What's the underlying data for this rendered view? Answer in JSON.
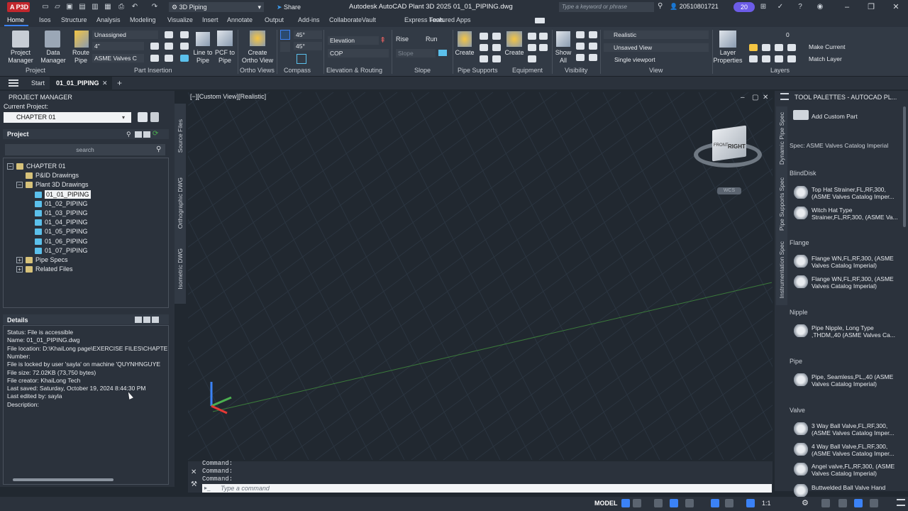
{
  "titlebar": {
    "app_badge": "A P3D",
    "workspace": "3D Piping",
    "share": "Share",
    "title": "Autodesk AutoCAD Plant 3D 2025   01_01_PIPING.dwg",
    "search_placeholder": "Type a keyword or phrase",
    "user": "20510801721",
    "notifications": "20"
  },
  "ribbon_tabs": [
    "Home",
    "Isos",
    "Structure",
    "Analysis",
    "Modeling",
    "Visualize",
    "Insert",
    "Annotate",
    "Output",
    "Add-ins",
    "Collaborate",
    "Vault",
    "Express Tools",
    "Featured Apps"
  ],
  "ribbon": {
    "project_manager": "Project\nManager",
    "data_manager": "Data\nManager",
    "route_pipe": "Route\nPipe",
    "layer_dropdown": "Unassigned",
    "size_dropdown": "4\"",
    "spec_dropdown": "ASME Valves C",
    "line_to_pipe": "Line to\nPipe",
    "pcf_to_pipe": "PCF to\nPipe",
    "create_ortho_view": "Create\nOrtho View",
    "angle1": "45°",
    "angle2": "45°",
    "elevation": "Elevation",
    "cop": "COP",
    "rise": "Rise",
    "run": "Run",
    "slope": "Slope",
    "create_supports": "Create",
    "create_equipment": "Create",
    "show_all": "Show\nAll",
    "visual_style": "Realistic",
    "saved_view": "Unsaved View",
    "viewport": "Single viewport",
    "layer_properties": "Layer\nProperties",
    "current_layer": "0",
    "make_current": "Make Current",
    "match_layer": "Match Layer",
    "groups": {
      "project": "Project",
      "part_insertion": "Part Insertion",
      "ortho_views": "Ortho Views",
      "compass": "Compass",
      "elevation_routing": "Elevation & Routing",
      "slope": "Slope",
      "pipe_supports": "Pipe Supports",
      "equipment": "Equipment",
      "visibility": "Visibility",
      "view": "View",
      "layers": "Layers"
    }
  },
  "doc_tabs": {
    "start": "Start",
    "active": "01_01_PIPING"
  },
  "project_manager": {
    "title": "PROJECT MANAGER",
    "current_project_label": "Current Project:",
    "current_project": "CHAPTER 01",
    "project_label": "Project",
    "search": "search",
    "tree": [
      {
        "label": "CHAPTER 01",
        "level": 0,
        "kind": "folder",
        "expand": "−"
      },
      {
        "label": "P&ID Drawings",
        "level": 1,
        "kind": "folder",
        "expand": ""
      },
      {
        "label": "Plant 3D Drawings",
        "level": 1,
        "kind": "folder",
        "expand": "−"
      },
      {
        "label": "01_01_PIPING",
        "level": 2,
        "kind": "file",
        "expand": "",
        "selected": true
      },
      {
        "label": "01_02_PIPING",
        "level": 2,
        "kind": "file",
        "expand": ""
      },
      {
        "label": "01_03_PIPING",
        "level": 2,
        "kind": "file",
        "expand": ""
      },
      {
        "label": "01_04_PIPING",
        "level": 2,
        "kind": "file",
        "expand": ""
      },
      {
        "label": "01_05_PIPING",
        "level": 2,
        "kind": "file",
        "expand": ""
      },
      {
        "label": "01_06_PIPING",
        "level": 2,
        "kind": "file",
        "expand": ""
      },
      {
        "label": "01_07_PIPING",
        "level": 2,
        "kind": "file",
        "expand": ""
      },
      {
        "label": "Pipe Specs",
        "level": 1,
        "kind": "folder",
        "expand": "+"
      },
      {
        "label": "Related Files",
        "level": 1,
        "kind": "folder",
        "expand": "+"
      }
    ],
    "details_label": "Details",
    "details": [
      "Status: File is accessible",
      "Name: 01_01_PIPING.dwg",
      "File location: D:\\KhaiLong page\\EXERCISE FILES\\CHAPTE",
      "Number:",
      "File is locked by user 'sayla' on machine 'QUYNHNGUYE",
      "File size: 72.02KB (73,750 bytes)",
      "File creator: KhaiLong Tech",
      "Last saved: Saturday, October 19, 2024 8:44:30 PM",
      "Last edited by: sayla",
      "Description:"
    ],
    "side_tabs": [
      "Source Files",
      "Orthographic DWG",
      "Isometric DWG"
    ]
  },
  "viewport": {
    "label": "[−][Custom View][Realistic]",
    "cube_face": "RIGHT",
    "cube_top": "FRONT",
    "wcs": "WCS"
  },
  "command": {
    "history": [
      "Command:",
      "Command:",
      "Command:"
    ],
    "placeholder": "Type a command"
  },
  "tool_palette": {
    "title": "TOOL PALETTES - AUTOCAD PL...",
    "side_tabs": [
      "Dynamic Pipe Spec",
      "Pipe Supports Spec",
      "Instrumentation Spec"
    ],
    "add_custom_part": "Add Custom Part",
    "spec": "Spec: ASME Valves Catalog Imperial",
    "sections": [
      {
        "category": "BlindDisk",
        "items": [
          "Top Hat Strainer,FL,RF,300,\n(ASME Valves Catalog Imper...",
          "Witch Hat Type\nStrainer,FL,RF,300, (ASME Va..."
        ]
      },
      {
        "category": "Flange",
        "items": [
          "Flange WN,FL,RF,300, (ASME\nValves Catalog Imperial)",
          "Flange WN,FL,RF,300, (ASME\nValves Catalog Imperial)"
        ]
      },
      {
        "category": "Nipple",
        "items": [
          "Pipe Nipple, Long Type\n,THDM,,40 (ASME Valves Ca..."
        ]
      },
      {
        "category": "Pipe",
        "items": [
          "Pipe, Seamless,PL,,40 (ASME\nValves Catalog Imperial)"
        ]
      },
      {
        "category": "Valve",
        "items": [
          "3 Way Ball Valve,FL,RF,300,\n(ASME Valves Catalog Imper...",
          "4 Way Ball Valve,FL,RF,300,\n(ASME Valves Catalog Imper...",
          "Angel valve,FL,RF,300, (ASME\nValves Catalog Imperial)",
          "Buttwelded Ball Valve Hand"
        ]
      }
    ]
  },
  "statusbar": {
    "model": "MODEL",
    "scale": "1:1"
  }
}
